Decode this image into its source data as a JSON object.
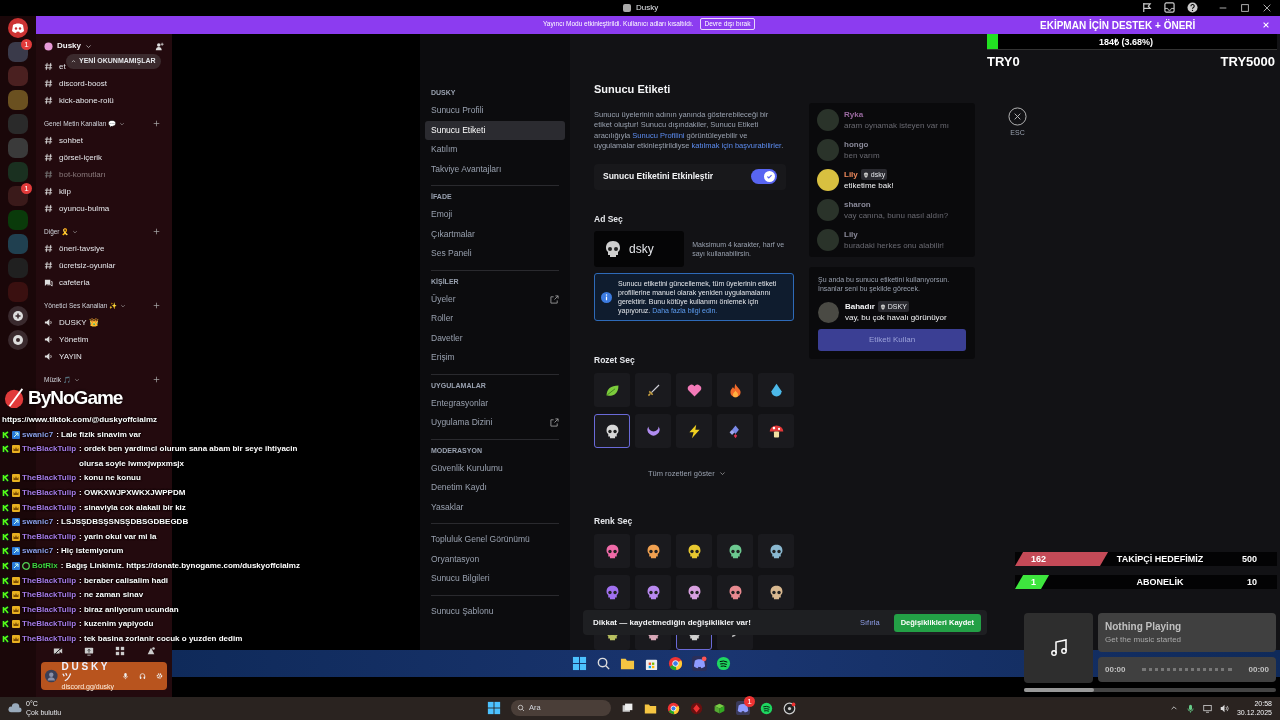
{
  "titlebar": {
    "title": "Dusky"
  },
  "banner": {
    "text": "Yayıncı Modu etkinleştirildi. Kullanıcı adları kısaltıldı.",
    "button": "Devre dışı bırak"
  },
  "server_rail": [
    {
      "kind": "home"
    },
    {
      "kind": "server",
      "badge": "1"
    },
    {
      "kind": "server"
    },
    {
      "kind": "server"
    },
    {
      "kind": "server"
    },
    {
      "kind": "server"
    },
    {
      "kind": "server"
    },
    {
      "kind": "server",
      "badge": "1"
    },
    {
      "kind": "server"
    },
    {
      "kind": "server"
    },
    {
      "kind": "server"
    },
    {
      "kind": "server"
    },
    {
      "kind": "add"
    },
    {
      "kind": "discover"
    }
  ],
  "sidebar": {
    "server_name": "Dusky",
    "unread_pill": "YENİ OKUNMAMIŞLAR",
    "items": [
      {
        "kind": "text",
        "label": "et",
        "muted": false
      },
      {
        "kind": "text",
        "label": "discord-boost",
        "muted": false
      },
      {
        "kind": "text",
        "label": "kick-abone-rolü",
        "muted": false
      },
      {
        "kind": "category",
        "label": "Genel Metin Kanalları 💬"
      },
      {
        "kind": "text",
        "label": "sohbet",
        "muted": false
      },
      {
        "kind": "text",
        "label": "görsel-içerik",
        "muted": false
      },
      {
        "kind": "text",
        "label": "bot-komutları",
        "muted": true
      },
      {
        "kind": "text",
        "label": "klip",
        "muted": false
      },
      {
        "kind": "text",
        "label": "oyuncu-bulma",
        "muted": false
      },
      {
        "kind": "category",
        "label": "Diğer 🎗️"
      },
      {
        "kind": "text",
        "label": "öneri-tavsiye",
        "muted": false
      },
      {
        "kind": "text",
        "label": "ücretsiz-oyunlar",
        "muted": false
      },
      {
        "kind": "forum",
        "label": "cafeteria",
        "muted": false
      },
      {
        "kind": "category",
        "label": "Yönetici Ses Kanalları ✨"
      },
      {
        "kind": "voice",
        "label": "DUSKY 👑",
        "muted": false
      },
      {
        "kind": "voice",
        "label": "Yönetim",
        "muted": false
      },
      {
        "kind": "voice",
        "label": "YAYIN",
        "muted": false
      },
      {
        "kind": "category",
        "label": "Müzik 🎵"
      }
    ],
    "user_panel": {
      "name": "D U S K Y ツ",
      "status": "discord.gg/dusky"
    }
  },
  "settings_nav": [
    {
      "header": "DUSKY",
      "items": [
        {
          "label": "Sunucu Profili",
          "selected": false,
          "external": false
        },
        {
          "label": "Sunucu Etiketi",
          "selected": true,
          "external": false
        },
        {
          "label": "Katılım",
          "selected": false,
          "external": false
        },
        {
          "label": "Takviye Avantajları",
          "selected": false,
          "external": false
        }
      ]
    },
    {
      "header": "İFADE",
      "items": [
        {
          "label": "Emoji",
          "selected": false,
          "external": false
        },
        {
          "label": "Çıkartmalar",
          "selected": false,
          "external": false
        },
        {
          "label": "Ses Paneli",
          "selected": false,
          "external": false
        }
      ]
    },
    {
      "header": "KİŞİLER",
      "items": [
        {
          "label": "Üyeler",
          "selected": false,
          "external": true
        },
        {
          "label": "Roller",
          "selected": false,
          "external": false
        },
        {
          "label": "Davetler",
          "selected": false,
          "external": false
        },
        {
          "label": "Erişim",
          "selected": false,
          "external": false
        }
      ]
    },
    {
      "header": "UYGULAMALAR",
      "items": [
        {
          "label": "Entegrasyonlar",
          "selected": false,
          "external": false
        },
        {
          "label": "Uygulama Dizini",
          "selected": false,
          "external": true
        }
      ]
    },
    {
      "header": "MODERASYON",
      "items": [
        {
          "label": "Güvenlik Kurulumu",
          "selected": false,
          "external": false
        },
        {
          "label": "Denetim Kaydı",
          "selected": false,
          "external": false
        },
        {
          "label": "Yasaklar",
          "selected": false,
          "external": false
        }
      ]
    },
    {
      "items": [
        {
          "label": "Topluluk Genel Görünümü",
          "selected": false,
          "external": false
        },
        {
          "label": "Oryantasyon",
          "selected": false,
          "external": false
        },
        {
          "label": "Sunucu Bilgileri",
          "selected": false,
          "external": false
        }
      ]
    },
    {
      "items": [
        {
          "label": "Sunucu Şablonu",
          "selected": false,
          "external": false
        }
      ]
    }
  ],
  "content": {
    "title": "Sunucu Etiketi",
    "description": [
      {
        "kind": "text",
        "text": "Sunucu üyelerinin adının yanında gösterebileceği bir etiket oluştur! Sunucu dışındakiler, Sunucu Etiketi aracılığıyla "
      },
      {
        "kind": "link",
        "text": "Sunucu Profilini"
      },
      {
        "kind": "text",
        "text": " görüntüleyebilir ve uygulamalar etkinleştirildiyse "
      },
      {
        "kind": "link",
        "text": "katılmak için başvurabilirler"
      },
      {
        "kind": "text",
        "text": "."
      }
    ],
    "toggle": {
      "label": "Sunucu Etiketini Etkinleştir",
      "on": true
    },
    "name_heading": "Ad Seç",
    "tag_name": "dsky",
    "name_hint": "Maksimum 4 karakter, harf ve sayı kullanabilirsin.",
    "info": {
      "text": "Sunucu etiketini güncellemek, tüm üyelerinin etiketi profillerine manuel olarak yeniden uygulamalarını gerektirir. Bunu kötüye kullanımı önlemek için yapıyoruz.",
      "link": "Daha fazla bilgi edin."
    },
    "badge_heading": "Rozet Seç",
    "badges": [
      {
        "kind": "leaf",
        "selected": false
      },
      {
        "kind": "sword",
        "selected": false
      },
      {
        "kind": "heart",
        "selected": false
      },
      {
        "kind": "flame",
        "selected": false
      },
      {
        "kind": "drop",
        "selected": false
      },
      {
        "kind": "skull",
        "selected": true
      },
      {
        "kind": "moon",
        "selected": false
      },
      {
        "kind": "bolt",
        "selected": false
      },
      {
        "kind": "gem",
        "selected": false
      },
      {
        "kind": "mushroom",
        "selected": false
      }
    ],
    "show_all": "Tüm rozetleri göster",
    "color_heading": "Renk Seç",
    "colors": [
      {
        "kind": "swatch",
        "color": "#f06aa8",
        "selected": false
      },
      {
        "kind": "swatch",
        "color": "#f0a050",
        "selected": false
      },
      {
        "kind": "swatch",
        "color": "#e8c830",
        "selected": false
      },
      {
        "kind": "swatch",
        "color": "#6cc890",
        "selected": false
      },
      {
        "kind": "swatch",
        "color": "#8ab8d0",
        "selected": false
      },
      {
        "kind": "swatch",
        "color": "#a070f0",
        "selected": false
      },
      {
        "kind": "swatch",
        "color": "#b888f0",
        "selected": false
      },
      {
        "kind": "swatch",
        "color": "#d8a0e0",
        "selected": false
      },
      {
        "kind": "swatch",
        "color": "#e88a90",
        "selected": false
      },
      {
        "kind": "swatch",
        "color": "#d8b890",
        "selected": false
      },
      {
        "kind": "swatch",
        "color": "#b8c060",
        "selected": false
      },
      {
        "kind": "swatch",
        "color": "#d8a8b8",
        "selected": false
      },
      {
        "kind": "swatch",
        "color": "#d0d0d0",
        "selected": true
      },
      {
        "kind": "custom",
        "selected": false
      }
    ],
    "preview": [
      {
        "user": "Ryka",
        "text": "aram oynamak isteyen var mı",
        "color": "#9a6aa0",
        "dimmed": true
      },
      {
        "user": "hongo",
        "text": "ben varım",
        "color": "#8a8a9a",
        "dimmed": true
      },
      {
        "user": "Lily",
        "tag": "dsky",
        "text": "etiketime bak!",
        "color": "#f08a5d",
        "dimmed": false
      },
      {
        "user": "sharon",
        "text": "vay canına, bunu nasıl aldın?",
        "color": "#8a8a9a",
        "dimmed": true
      },
      {
        "user": "Lily",
        "text": "buradaki herkes onu alabilir!",
        "color": "#8a8a9a",
        "dimmed": true
      }
    ],
    "use_card": {
      "text": "Şu anda bu sunucu etiketini kullanıyorsun. İnsanlar seni bu şekilde görecek.",
      "user": "Bahadır",
      "tag": "DSKY",
      "message": "vay, bu çok havalı görünüyor",
      "button": "Etiketi Kullan"
    },
    "close_label": "ESC",
    "save_bar": {
      "text": "Dikkat — kaydetmediğin değişiklikler var!",
      "reset": "Sıfırla",
      "save": "Değişiklikleri Kaydet"
    }
  },
  "donation_goal": {
    "title": "EKİPMAN İÇİN DESTEK + ÖNERİ",
    "level": 0.0368,
    "amount": "184₺ (3.68%)",
    "min": "TRY0",
    "max": "TRY5000"
  },
  "goals": [
    {
      "current": "162",
      "label": "TAKİPÇİ HEDEFİMİZ",
      "target": "500",
      "level": 0.324,
      "color": "#c44a57"
    },
    {
      "current": "1",
      "label": "ABONELİK",
      "target": "10",
      "level": 0.1,
      "color": "#3ee63e"
    }
  ],
  "music": {
    "title": "Nothing Playing",
    "subtitle": "Get the music started",
    "elapsed": "00:00",
    "total": "00:00"
  },
  "chat_overlay": {
    "logo": "ByNoGame",
    "messages": [
      {
        "text": "https://www.tiktok.com/@duskyoffcialmz"
      },
      {
        "user": "swanic7",
        "badges": [
          {
            "kind": "kick"
          },
          {
            "kind": "blue"
          }
        ],
        "color": "#8c9ee8",
        "text": ": Lale fizik sinavim var"
      },
      {
        "user": "TheBlackTulip",
        "badges": [
          {
            "kind": "kick"
          },
          {
            "kind": "gold"
          }
        ],
        "color": "#a77be8",
        "text": ": ordek ben yardimci olurum sana abam bir seye ihtiyacin olursa soyle lwmxjwpxmsjx"
      },
      {
        "user": "TheBlackTulip",
        "badges": [
          {
            "kind": "kick"
          },
          {
            "kind": "gold"
          }
        ],
        "color": "#a77be8",
        "text": ": konu ne konuu"
      },
      {
        "user": "TheBlackTulip",
        "badges": [
          {
            "kind": "kick"
          },
          {
            "kind": "gold"
          }
        ],
        "color": "#a77be8",
        "text": ": OWKXWJPXWKXJWPPDM"
      },
      {
        "user": "TheBlackTulip",
        "badges": [
          {
            "kind": "kick"
          },
          {
            "kind": "gold"
          }
        ],
        "color": "#a77be8",
        "text": ": sinaviyla cok alakali bir kiz"
      },
      {
        "user": "swanic7",
        "badges": [
          {
            "kind": "kick"
          },
          {
            "kind": "blue"
          }
        ],
        "color": "#8c9ee8",
        "text": ": LSJSŞDBSŞSNSŞDBSGDBEGDB"
      },
      {
        "user": "TheBlackTulip",
        "badges": [
          {
            "kind": "kick"
          },
          {
            "kind": "gold"
          }
        ],
        "color": "#a77be8",
        "text": ": yarin okul var mi la"
      },
      {
        "user": "swanic7",
        "badges": [
          {
            "kind": "kick"
          },
          {
            "kind": "blue"
          }
        ],
        "color": "#8c9ee8",
        "text": ": Hiç istemiyorum"
      },
      {
        "user": "BotRix",
        "badges": [
          {
            "kind": "kick"
          },
          {
            "kind": "blue"
          },
          {
            "kind": "bot"
          }
        ],
        "color": "#3fd43f",
        "text": ": Bağış Linkimiz. https://donate.bynogame.com/duskyoffcialmz"
      },
      {
        "user": "TheBlackTulip",
        "badges": [
          {
            "kind": "kick"
          },
          {
            "kind": "gold"
          }
        ],
        "color": "#a77be8",
        "text": ": beraber calisalim hadi"
      },
      {
        "user": "TheBlackTulip",
        "badges": [
          {
            "kind": "kick"
          },
          {
            "kind": "gold"
          }
        ],
        "color": "#a77be8",
        "text": ": ne zaman sinav"
      },
      {
        "user": "TheBlackTulip",
        "badges": [
          {
            "kind": "kick"
          },
          {
            "kind": "gold"
          }
        ],
        "color": "#a77be8",
        "text": ": biraz anliyorum ucundan"
      },
      {
        "user": "TheBlackTulip",
        "badges": [
          {
            "kind": "kick"
          },
          {
            "kind": "gold"
          }
        ],
        "color": "#a77be8",
        "text": ": kuzenim yapiyodu"
      },
      {
        "user": "TheBlackTulip",
        "badges": [
          {
            "kind": "kick"
          },
          {
            "kind": "gold"
          }
        ],
        "color": "#a77be8",
        "text": ": tek basina zorlanir cocuk o yuzden dedim"
      }
    ]
  },
  "taskbar": {
    "search_placeholder": "Ara",
    "weather_temp": "0°C",
    "weather_text": "Çok bulutlu",
    "time": "20:58",
    "date": "30.12.2025",
    "discord_badge": "1"
  }
}
